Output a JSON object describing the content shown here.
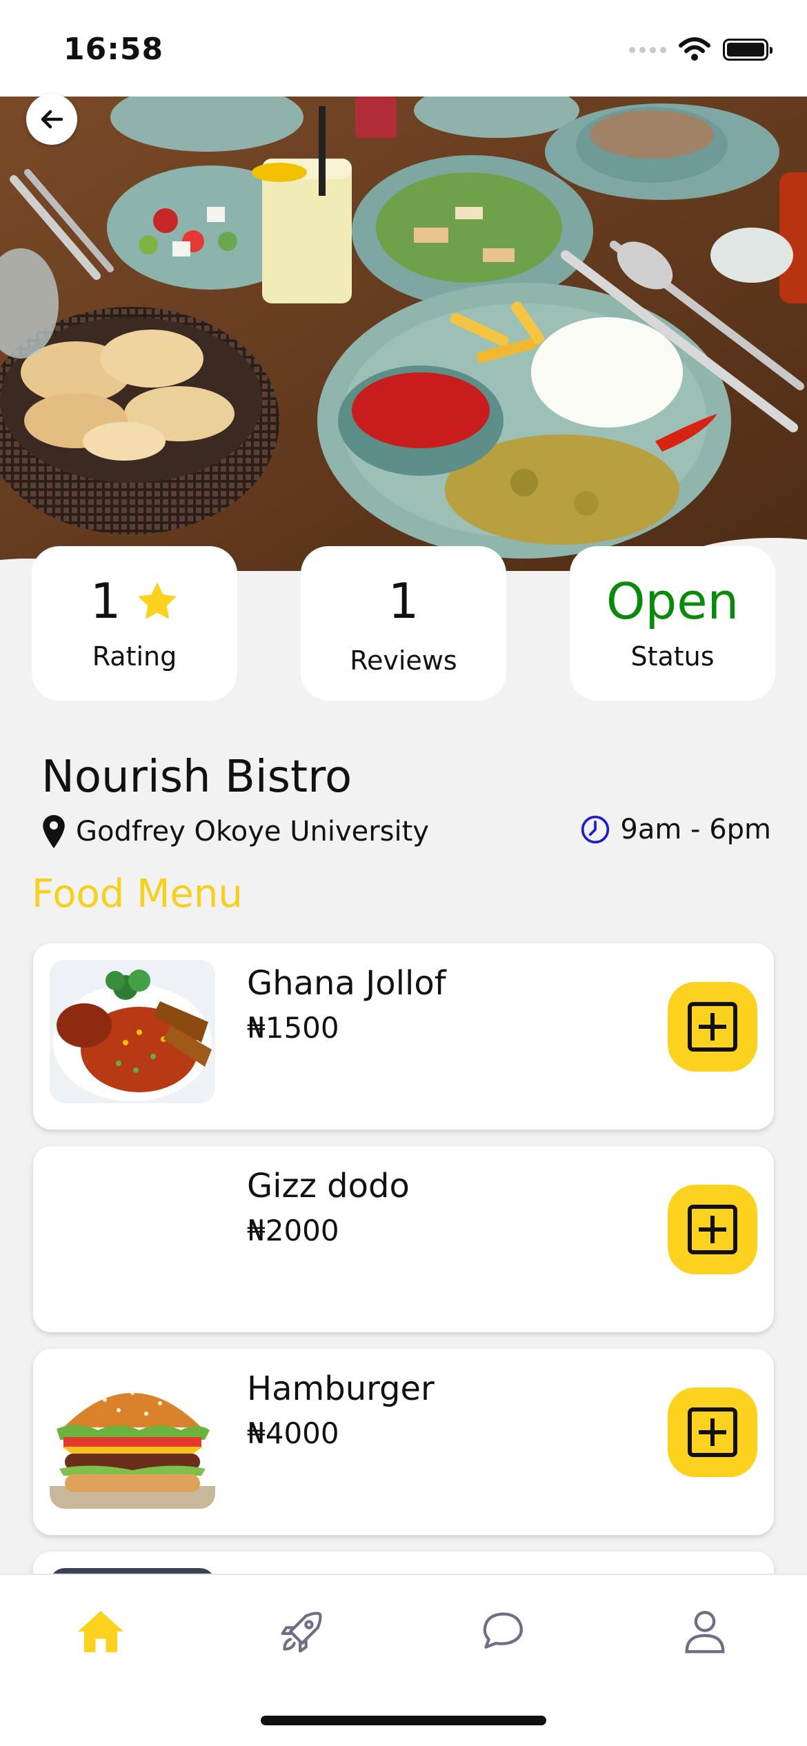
{
  "status_bar": {
    "time": "16:58"
  },
  "stats": [
    {
      "value": "1",
      "label": "Rating"
    },
    {
      "value": "1",
      "label": "Reviews"
    },
    {
      "value": "Open",
      "label": "Status"
    }
  ],
  "restaurant": {
    "name": "Nourish Bistro",
    "location": "Godfrey Okoye University",
    "hours": "9am - 6pm"
  },
  "menu": {
    "heading": "Food Menu",
    "items": [
      {
        "name": "Ghana Jollof",
        "price": "₦1500"
      },
      {
        "name": "Gizz dodo",
        "price": "₦2000"
      },
      {
        "name": "Hamburger",
        "price": "₦4000"
      }
    ]
  },
  "nav": {
    "active": "home",
    "items": [
      "home-icon",
      "rocket-icon",
      "chat-icon",
      "profile-icon"
    ]
  },
  "colors": {
    "accent_yellow": "#fdd21f",
    "open_green": "#0a8a0a",
    "clock_blue": "#1b1bd6"
  }
}
